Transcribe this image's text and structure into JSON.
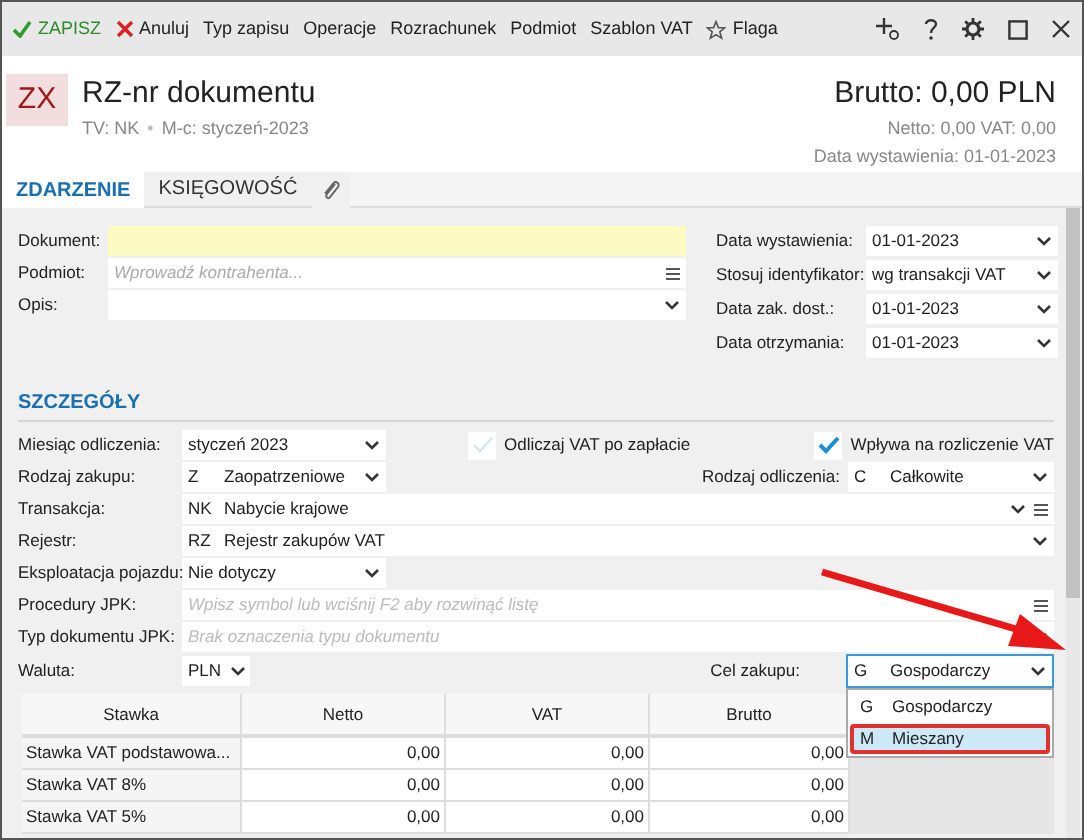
{
  "toolbar": {
    "items": [
      {
        "label": "ZAPISZ",
        "kind": "save"
      },
      {
        "label": "Anuluj",
        "kind": "cancel"
      },
      {
        "label": "Typ zapisu",
        "kind": "plain"
      },
      {
        "label": "Operacje",
        "kind": "plain"
      },
      {
        "label": "Rozrachunek",
        "kind": "plain"
      },
      {
        "label": "Podmiot",
        "kind": "plain"
      },
      {
        "label": "Szablon VAT",
        "kind": "plain"
      },
      {
        "label": "Flaga",
        "kind": "flag"
      }
    ]
  },
  "header": {
    "badge": "ZX",
    "title": "RZ-nr dokumentu",
    "meta": [
      "TV: NK",
      "M-c: styczeń-2023"
    ],
    "meta_separator": "•",
    "total": "Brutto: 0,00 PLN",
    "summary": "Netto: 0,00 VAT: 0,00",
    "issue_date": "Data wystawienia: 01-01-2023"
  },
  "tabs": [
    {
      "label": "ZDARZENIE",
      "selected": true
    },
    {
      "label": "KSIĘGOWOŚĆ",
      "selected": false
    }
  ],
  "event_left": [
    {
      "label": "Dokument:",
      "kind": "highlight"
    },
    {
      "label": "Podmiot:",
      "kind": "lookup",
      "placeholder": "Wprowadź kontrahenta..."
    },
    {
      "label": "Opis:",
      "kind": "dropdown"
    }
  ],
  "event_right": [
    {
      "label": "Data wystawienia:",
      "value": "01-01-2023"
    },
    {
      "label": "Stosuj identyfikator:",
      "value": "wg transakcji VAT"
    },
    {
      "label": "Data zak. dost.:",
      "value": "01-01-2023"
    },
    {
      "label": "Data otrzymania:",
      "value": "01-01-2023"
    }
  ],
  "details": {
    "title": "SZCZEGÓŁY",
    "month": {
      "label": "Miesiąc odliczenia:",
      "value": "styczeń 2023"
    },
    "deduct_after_payment": {
      "label": "Odliczaj VAT po zapłacie",
      "checked": false
    },
    "affects_vat": {
      "label": "Wpływa na rozliczenie VAT",
      "checked": true
    },
    "purchase_type": {
      "label": "Rodzaj zakupu:",
      "code": "Z",
      "value": "Zaopatrzeniowe"
    },
    "deduction_type": {
      "label": "Rodzaj odliczenia:",
      "code": "C",
      "value": "Całkowite"
    },
    "transaction": {
      "label": "Transakcja:",
      "code": "NK",
      "value": "Nabycie krajowe"
    },
    "register": {
      "label": "Rejestr:",
      "code": "RZ",
      "value": "Rejestr zakupów VAT"
    },
    "vehicle": {
      "label": "Eksploatacja pojazdu:",
      "value": "Nie dotyczy"
    },
    "jpk_procedures": {
      "label": "Procedury JPK:",
      "placeholder": "Wpisz symbol lub wciśnij F2 aby rozwinąć listę"
    },
    "jpk_doc_type": {
      "label": "Typ dokumentu JPK:",
      "placeholder": "Brak oznaczenia typu dokumentu"
    },
    "currency": {
      "label": "Waluta:",
      "value": "PLN"
    },
    "purpose": {
      "label": "Cel zakupu:",
      "code": "G",
      "value": "Gospodarczy",
      "expanded": true,
      "options": [
        {
          "code": "G",
          "label": "Gospodarczy",
          "highlighted": false
        },
        {
          "code": "M",
          "label": "Mieszany",
          "highlighted": true
        }
      ]
    }
  },
  "table": {
    "columns": [
      "Stawka",
      "Netto",
      "VAT",
      "Brutto"
    ],
    "rows": [
      [
        "Stawka VAT podstawowa...",
        "0,00",
        "0,00",
        "0,00"
      ],
      [
        "Stawka VAT 8%",
        "0,00",
        "0,00",
        "0,00"
      ],
      [
        "Stawka VAT 5%",
        "0,00",
        "0,00",
        "0,00"
      ]
    ]
  }
}
